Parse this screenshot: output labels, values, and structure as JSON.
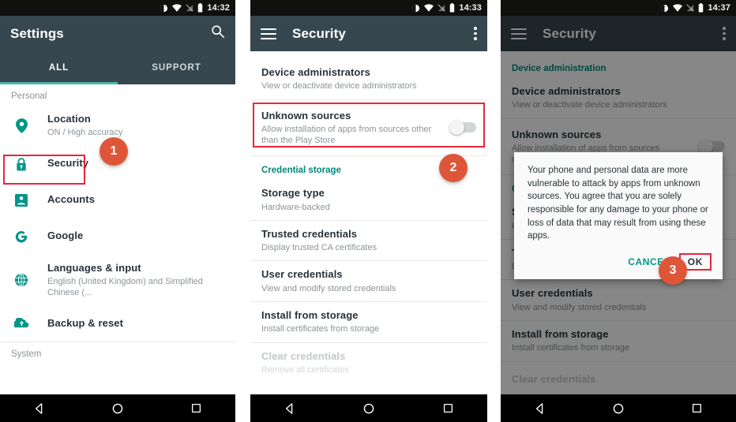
{
  "panels": [
    {
      "id": "settings",
      "statusbar": {
        "time": "14:32",
        "icons": [
          "dnd-icon",
          "wifi-icon",
          "signal-off-icon",
          "battery-icon"
        ]
      },
      "appbar": {
        "title": "Settings",
        "action_icon": "search-icon"
      },
      "tabs": [
        {
          "label": "ALL",
          "active": true
        },
        {
          "label": "SUPPORT",
          "active": false
        }
      ],
      "sections": [
        {
          "label": "Personal"
        },
        {
          "label": "System"
        }
      ],
      "items": [
        {
          "icon": "location-pin-icon",
          "primary": "Location",
          "secondary": "ON / High accuracy"
        },
        {
          "icon": "lock-icon",
          "primary": "Security",
          "secondary": ""
        },
        {
          "icon": "account-box-icon",
          "primary": "Accounts",
          "secondary": ""
        },
        {
          "icon": "google-g-icon",
          "primary": "Google",
          "secondary": ""
        },
        {
          "icon": "globe-icon",
          "primary": "Languages & input",
          "secondary": "English (United Kingdom) and Simplified Chinese (..."
        },
        {
          "icon": "cloud-upload-icon",
          "primary": "Backup & reset",
          "secondary": ""
        }
      ],
      "badge": "1"
    },
    {
      "id": "security",
      "statusbar": {
        "time": "14:33",
        "icons": [
          "dnd-icon",
          "wifi-icon",
          "signal-off-icon",
          "battery-icon"
        ]
      },
      "appbar": {
        "title": "Security",
        "nav_icon": "hamburger-icon",
        "action_icon": "overflow-menu-icon"
      },
      "section_label": "Credential storage",
      "items": [
        {
          "primary": "Device administrators",
          "secondary": "View or deactivate device administrators"
        },
        {
          "primary": "Unknown sources",
          "secondary": "Allow installation of apps from sources other than the Play Store",
          "toggle": "off"
        },
        {
          "primary": "Storage type",
          "secondary": "Hardware-backed"
        },
        {
          "primary": "Trusted credentials",
          "secondary": "Display trusted CA certificates"
        },
        {
          "primary": "User credentials",
          "secondary": "View and modify stored credentials"
        },
        {
          "primary": "Install from storage",
          "secondary": "Install certificates from storage"
        },
        {
          "primary": "Clear credentials",
          "secondary": "Remove all certificates",
          "disabled": true
        }
      ],
      "badge": "2"
    },
    {
      "id": "security-dialog",
      "statusbar": {
        "time": "14:37",
        "icons": [
          "dnd-icon",
          "wifi-icon",
          "signal-off-icon",
          "battery-icon"
        ]
      },
      "appbar": {
        "title": "Security",
        "nav_icon": "hamburger-icon",
        "action_icon": "overflow-menu-icon"
      },
      "section_label": "Device administration",
      "items": [
        {
          "primary": "Device administrators",
          "secondary": "View or deactivate device administrators"
        },
        {
          "primary": "Unknown sources",
          "secondary": "Allow installation of apps from sources other than the Play Store",
          "toggle": "off"
        },
        {
          "primary": "Credential storage",
          "secondary": ""
        },
        {
          "primary": "Storage type",
          "secondary": "Hardware-backed"
        },
        {
          "primary": "Trusted credentials",
          "secondary": "Display trusted CA certificates"
        },
        {
          "primary": "User credentials",
          "secondary": "View and modify stored credentials"
        },
        {
          "primary": "Install from storage",
          "secondary": "Install certificates from storage"
        },
        {
          "primary": "Clear credentials",
          "secondary": "",
          "disabled": true
        }
      ],
      "dialog": {
        "message": "Your phone and personal data are more vulnerable to attack by apps from unknown sources. You agree that you are solely responsible for any damage to your phone or loss of data that may result from using these apps.",
        "cancel_label": "CANCEL",
        "ok_label": "OK"
      },
      "badge": "3"
    }
  ],
  "navbar": {
    "back": "back-triangle-icon",
    "home": "home-circle-icon",
    "recents": "recents-square-icon"
  },
  "colors": {
    "appbar": "#37474F",
    "accent_teal": "#009688",
    "tab_indicator": "#4DB6AC",
    "badge": "#DE5637",
    "highlight_red": "#E8253C",
    "statusbar": "#10100F"
  }
}
